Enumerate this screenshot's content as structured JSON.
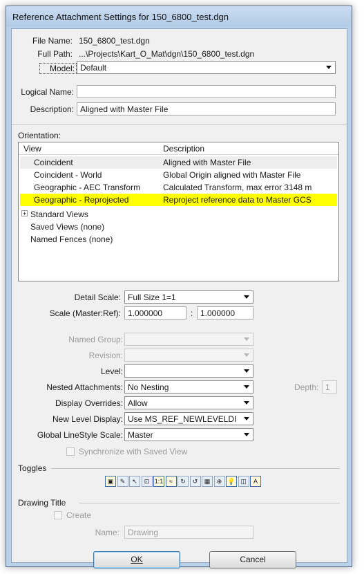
{
  "window": {
    "title": "Reference Attachment Settings for 150_6800_test.dgn"
  },
  "file": {
    "name_label": "File Name:",
    "name_value": "150_6800_test.dgn",
    "path_label": "Full Path:",
    "path_value": "...\\Projects\\Kart_O_Mat\\dgn\\150_6800_test.dgn",
    "model_label": "Model:",
    "model_value": "Default",
    "logical_label": "Logical Name:",
    "logical_value": "",
    "description_label": "Description:",
    "description_value": "Aligned with Master File"
  },
  "orientation": {
    "label": "Orientation:",
    "columns": [
      "View",
      "Description"
    ],
    "rows": [
      {
        "view": "Coincident",
        "description": "Aligned with Master File",
        "state": "hover"
      },
      {
        "view": "Coincident - World",
        "description": "Global Origin aligned with Master File",
        "state": ""
      },
      {
        "view": "Geographic - AEC Transform",
        "description": "Calculated Transform, max error 3148 m",
        "state": ""
      },
      {
        "view": "Geographic - Reprojected",
        "description": "Reproject reference data to Master GCS",
        "state": "selected"
      }
    ],
    "tree": [
      {
        "label": "Standard Views",
        "expander": "+"
      },
      {
        "label": "Saved Views (none)",
        "expander": ""
      },
      {
        "label": "Named Fences (none)",
        "expander": ""
      }
    ],
    "selected_color": "#ffff00"
  },
  "scale": {
    "detail_label": "Detail Scale:",
    "detail_value": "Full Size 1=1",
    "ratio_label": "Scale (Master:Ref):",
    "master_value": "1.000000",
    "colon": ":",
    "ref_value": "1.000000"
  },
  "attach": {
    "named_group_label": "Named Group:",
    "named_group_value": "",
    "revision_label": "Revision:",
    "revision_value": "",
    "level_label": "Level:",
    "level_value": "",
    "nested_label": "Nested Attachments:",
    "nested_value": "No Nesting",
    "depth_label": "Depth:",
    "depth_value": "1",
    "overrides_label": "Display Overrides:",
    "overrides_value": "Allow",
    "newlevel_label": "New Level Display:",
    "newlevel_value": "Use MS_REF_NEWLEVELDI",
    "linestyle_label": "Global LineStyle Scale:",
    "linestyle_value": "Master",
    "sync_label": "Synchronize with Saved View"
  },
  "toggles": {
    "label": "Toggles",
    "icons": [
      {
        "name": "display-toggle-icon",
        "glyph": "▣",
        "on": true
      },
      {
        "name": "snap-toggle-icon",
        "glyph": "✎",
        "on": false
      },
      {
        "name": "locate-toggle-icon",
        "glyph": "↖",
        "on": false
      },
      {
        "name": "ignore-attachment-icon",
        "glyph": "⊡",
        "on": false
      },
      {
        "name": "true-scale-toggle-icon",
        "glyph": "1:1",
        "on": true
      },
      {
        "name": "scale-linestyles-icon",
        "glyph": "≈",
        "on": true
      },
      {
        "name": "rotate-left-icon",
        "glyph": "↻",
        "on": false
      },
      {
        "name": "rotate-right-icon",
        "glyph": "↺",
        "on": false
      },
      {
        "name": "raster-display-icon",
        "glyph": "▦",
        "on": false
      },
      {
        "name": "treat-as-element-icon",
        "glyph": "⊕",
        "on": false
      },
      {
        "name": "use-lights-icon",
        "glyph": "💡",
        "on": true
      },
      {
        "name": "clip-boundary-icon",
        "glyph": "◫",
        "on": false
      },
      {
        "name": "annotation-scale-icon",
        "glyph": "A",
        "on": true
      }
    ]
  },
  "drawing": {
    "label": "Drawing Title",
    "create_label": "Create",
    "name_label": "Name:",
    "name_value": "Drawing"
  },
  "buttons": {
    "ok": "OK",
    "cancel": "Cancel"
  }
}
